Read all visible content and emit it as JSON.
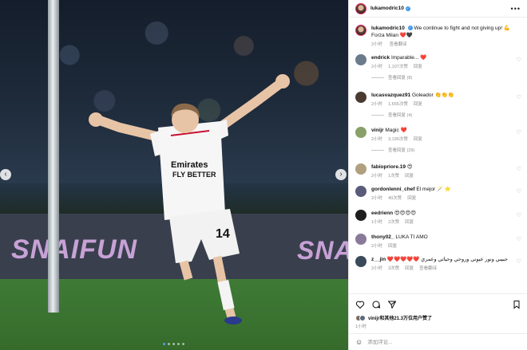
{
  "post": {
    "username": "lukamodric10",
    "more_icon": "ellipsis-icon"
  },
  "photo": {
    "board_text_left": "SNAIFUN",
    "board_text_right": "SNAI",
    "carousel_dots": 5,
    "active_dot": 1
  },
  "caption": {
    "username": "lukamodric10",
    "text": "We continue to fight and not giving up! 💪 Forza Milan ❤️🖤",
    "time": "2小时",
    "translate": "查看翻译"
  },
  "comments": [
    {
      "username": "endrick",
      "text": "Imparable... ❤️",
      "time": "2小时",
      "likes": "1,107次赞",
      "reply": "回复",
      "view_replies": "查看回复 (8)",
      "avatar_color": "#6b7b8c"
    },
    {
      "username": "lucasvazquez91",
      "text": "Goleador 👏👏👏",
      "time": "2小时",
      "likes": "1,655次赞",
      "reply": "回复",
      "view_replies": "查看回复 (4)",
      "avatar_color": "#4a3a30"
    },
    {
      "username": "vinijr",
      "text": "Magic ❤️",
      "time": "2小时",
      "likes": "3,199次赞",
      "reply": "回复",
      "view_replies": "查看回复 (29)",
      "avatar_color": "#8aa06a"
    },
    {
      "username": "fabiopriore.19",
      "text": "😍",
      "time": "2小时",
      "likes": "1次赞",
      "reply": "回复",
      "view_replies": "",
      "avatar_color": "#b0a080"
    },
    {
      "username": "gordonlenni_chef",
      "text": "El mejor 🪄 ⭐",
      "time": "2小时",
      "likes": "40次赞",
      "reply": "回复",
      "view_replies": "",
      "avatar_color": "#5a5a7a"
    },
    {
      "username": "eedrienn",
      "text": "😍😍😍😍",
      "time": "1小时",
      "likes": "2次赞",
      "reply": "回复",
      "view_replies": "",
      "avatar_color": "#1e1e1e"
    },
    {
      "username": "thony02_",
      "text": "LUKA TI AMO",
      "time": "2小时",
      "likes": "",
      "reply": "回复",
      "view_replies": "",
      "avatar_color": "#8a7a9a"
    },
    {
      "username": "z__jin",
      "text": "❤️❤️❤️❤️❤️ حبيبي ونور عيوني وروحي وحياتي وعمري",
      "time": "2小时",
      "likes": "3次赞",
      "reply": "回复",
      "translate": "查看翻译",
      "view_replies": "",
      "avatar_color": "#3a4a5a"
    }
  ],
  "actions": {
    "liked_by": "vinijr和其他21.3万位用户赞了",
    "time": "1小时",
    "input_placeholder": "添加评论..."
  }
}
